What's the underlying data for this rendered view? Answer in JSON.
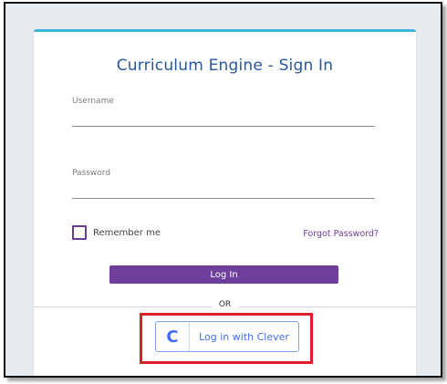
{
  "login_form": {
    "title": "Curriculum Engine - Sign In",
    "username_label": "Username",
    "username_value": "",
    "password_label": "Password",
    "password_value": "",
    "remember_me_label": "Remember me",
    "remember_me_checked": false,
    "forgot_password_label": "Forgot Password?",
    "login_button_label": "Log In",
    "divider_label": "OR"
  },
  "clever": {
    "logo_letter": "C",
    "button_label": "Log in with Clever"
  },
  "colors": {
    "accent_top_border": "#3fb3e0",
    "title": "#27589a",
    "primary_button": "#6e3f9c",
    "clever_blue": "#436cf2",
    "highlight_box": "#dd1f2a"
  }
}
